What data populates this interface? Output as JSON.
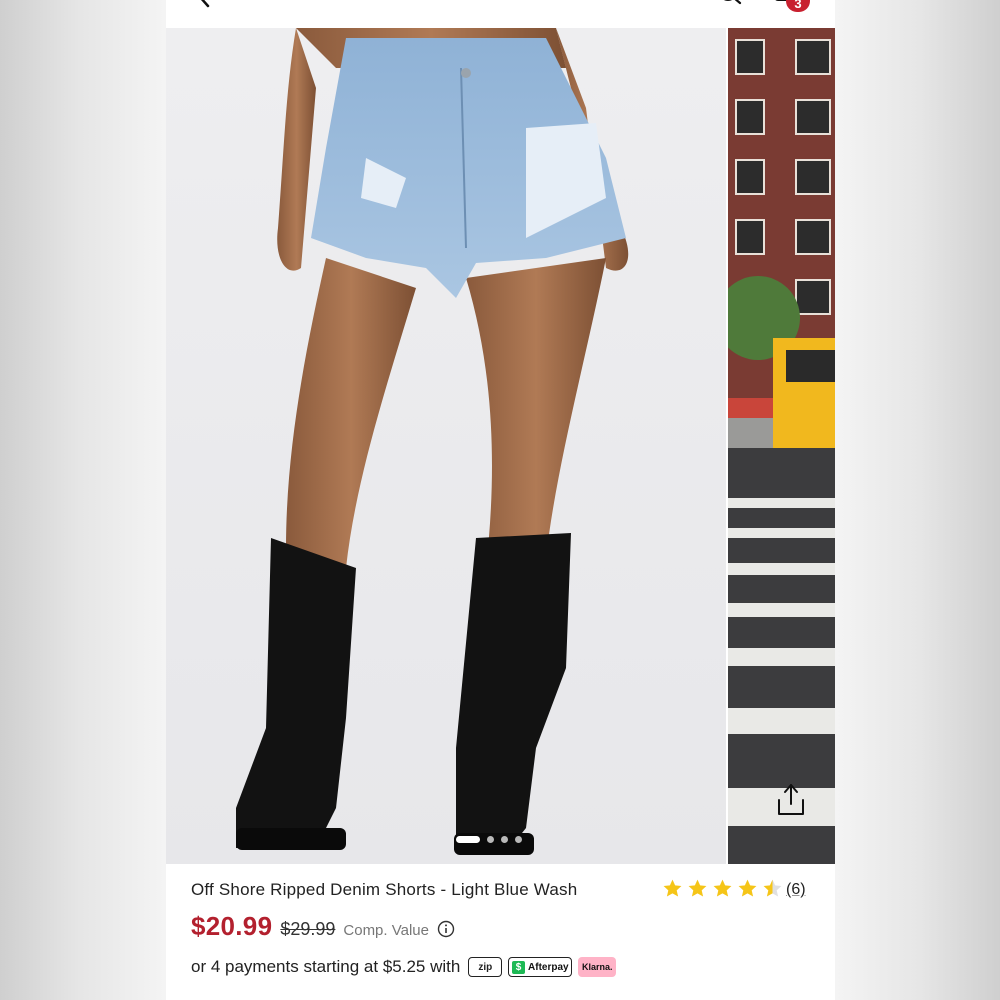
{
  "header": {
    "cart_count": "3"
  },
  "gallery": {
    "dot_count": 4,
    "active_dot": 0
  },
  "product": {
    "title": "Off Shore Ripped Denim Shorts - Light Blue Wash",
    "rating": 4.5,
    "rating_count": "(6)",
    "price": "$20.99",
    "original_price": "$29.99",
    "comp_value_label": "Comp. Value"
  },
  "payments": {
    "text": "or 4 payments starting at $5.25 with",
    "zip_label": "zip",
    "afterpay_label": "Afterpay",
    "klarna_label": "Klarna."
  },
  "colors": {
    "price_red": "#b3202e",
    "star_gold": "#f5c518",
    "badge_red": "#c8202f",
    "afterpay_green": "#1db954",
    "klarna_pink": "#ffb3c7"
  },
  "icons": {
    "back": "back-arrow-icon",
    "search": "search-icon",
    "bag": "shopping-bag-icon",
    "share": "share-icon",
    "info": "info-icon",
    "star": "star-icon"
  }
}
